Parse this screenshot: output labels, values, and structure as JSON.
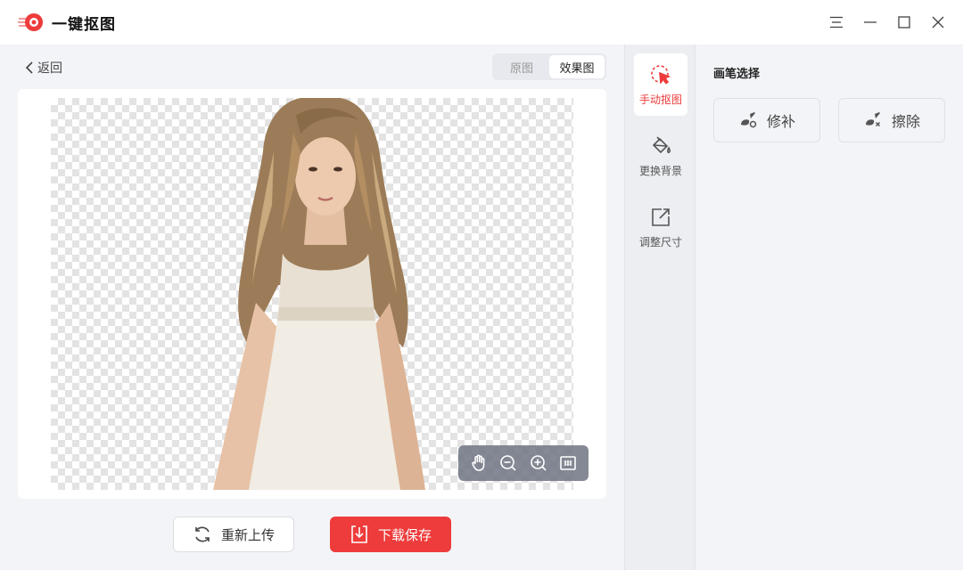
{
  "app": {
    "title": "一键抠图",
    "brand_color": "#ee3b3b"
  },
  "window_controls": {
    "menu_icon": "menu-icon",
    "minimize_icon": "minimize-icon",
    "maximize_icon": "maximize-icon",
    "close_icon": "close-icon"
  },
  "main": {
    "back_label": "返回",
    "view_toggle": {
      "options": [
        "原图",
        "效果图"
      ],
      "selected": "效果图"
    },
    "zoom_tools": [
      "hand-icon",
      "zoom-out-icon",
      "zoom-in-icon",
      "fit-1to1-icon"
    ],
    "reupload_label": "重新上传",
    "save_label": "下载保存"
  },
  "tools": {
    "items": [
      {
        "label": "手动抠图",
        "icon": "manual-cutout-icon",
        "active": true
      },
      {
        "label": "更换背景",
        "icon": "paint-bucket-icon",
        "active": false
      },
      {
        "label": "调整尺寸",
        "icon": "resize-icon",
        "active": false
      }
    ]
  },
  "panel": {
    "title": "画笔选择",
    "brushes": [
      {
        "label": "修补",
        "icon": "repair-brush-icon"
      },
      {
        "label": "擦除",
        "icon": "erase-brush-icon"
      }
    ]
  }
}
